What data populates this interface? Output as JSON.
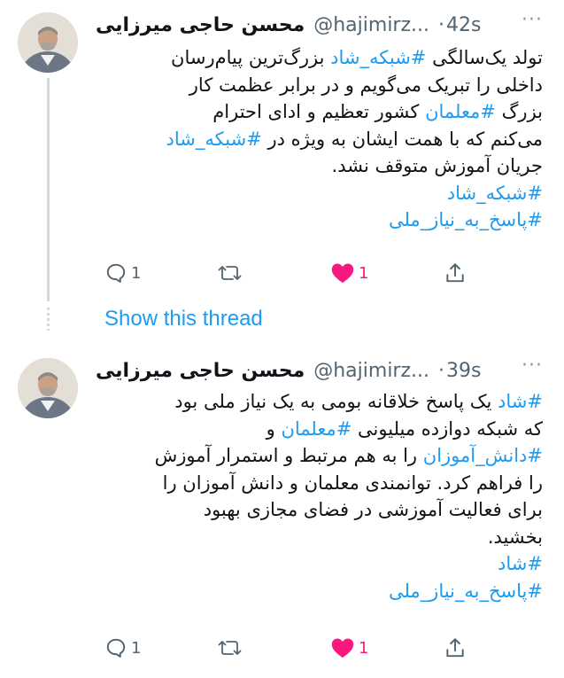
{
  "tweets": [
    {
      "name": "محسن حاجی میرزایی",
      "handle": "@hajimirz...",
      "time": "42s",
      "lines": [
        [
          {
            "t": "تولد یک‌سالگی "
          },
          {
            "t": "#شبکه_شاد",
            "tag": true
          },
          {
            "t": " بزرگ‌ترین پیام‌رسان"
          }
        ],
        [
          {
            "t": "داخلی را تبریک می‌گویم و در برابر عظمت کار"
          }
        ],
        [
          {
            "t": "بزرگ "
          },
          {
            "t": "#معلمان",
            "tag": true
          },
          {
            "t": " کشور تعظیم و ادای احترام"
          }
        ],
        [
          {
            "t": "می‌کنم که با همت ایشان به ویژه در "
          },
          {
            "t": "#شبکه_شاد",
            "tag": true
          }
        ],
        [
          {
            "t": "جریان آموزش متوقف نشد."
          }
        ],
        [
          {
            "t": "#شبکه_شاد",
            "tag": true
          }
        ],
        [
          {
            "t": "#پاسخ_به_نیاز_ملی",
            "tag": true
          }
        ]
      ],
      "replies": "1",
      "likes": "1"
    },
    {
      "name": "محسن حاجی میرزایی",
      "handle": "@hajimirz...",
      "time": "39s",
      "lines": [
        [
          {
            "t": "#شاد",
            "tag": true
          },
          {
            "t": " یک پاسخ خلاقانه بومی به یک نیاز ملی بود"
          }
        ],
        [
          {
            "t": "که شبکه دوازده میلیونی "
          },
          {
            "t": "#معلمان",
            "tag": true
          },
          {
            "t": " و"
          }
        ],
        [
          {
            "t": "#دانش_آموزان",
            "tag": true
          },
          {
            "t": " را به هم مرتبط و استمرار آموزش"
          }
        ],
        [
          {
            "t": "را فراهم کرد. توانمندی معلمان و دانش آموزان را"
          }
        ],
        [
          {
            "t": "برای فعالیت آموزشی در فضای مجازی بهبود"
          }
        ],
        [
          {
            "t": "بخشید."
          }
        ],
        [
          {
            "t": "#شاد",
            "tag": true
          }
        ],
        [
          {
            "t": "#پاسخ_به_نیاز_ملی",
            "tag": true
          }
        ]
      ],
      "replies": "1",
      "likes": "1"
    }
  ],
  "show_thread": "Show this thread",
  "icons": {
    "reply": "reply-icon",
    "retweet": "retweet-icon",
    "like": "heart-icon-filled",
    "share": "share-icon",
    "more": "more-icon"
  },
  "colors": {
    "link": "#1d9bf0",
    "like": "#f91880",
    "muted": "#536471"
  }
}
